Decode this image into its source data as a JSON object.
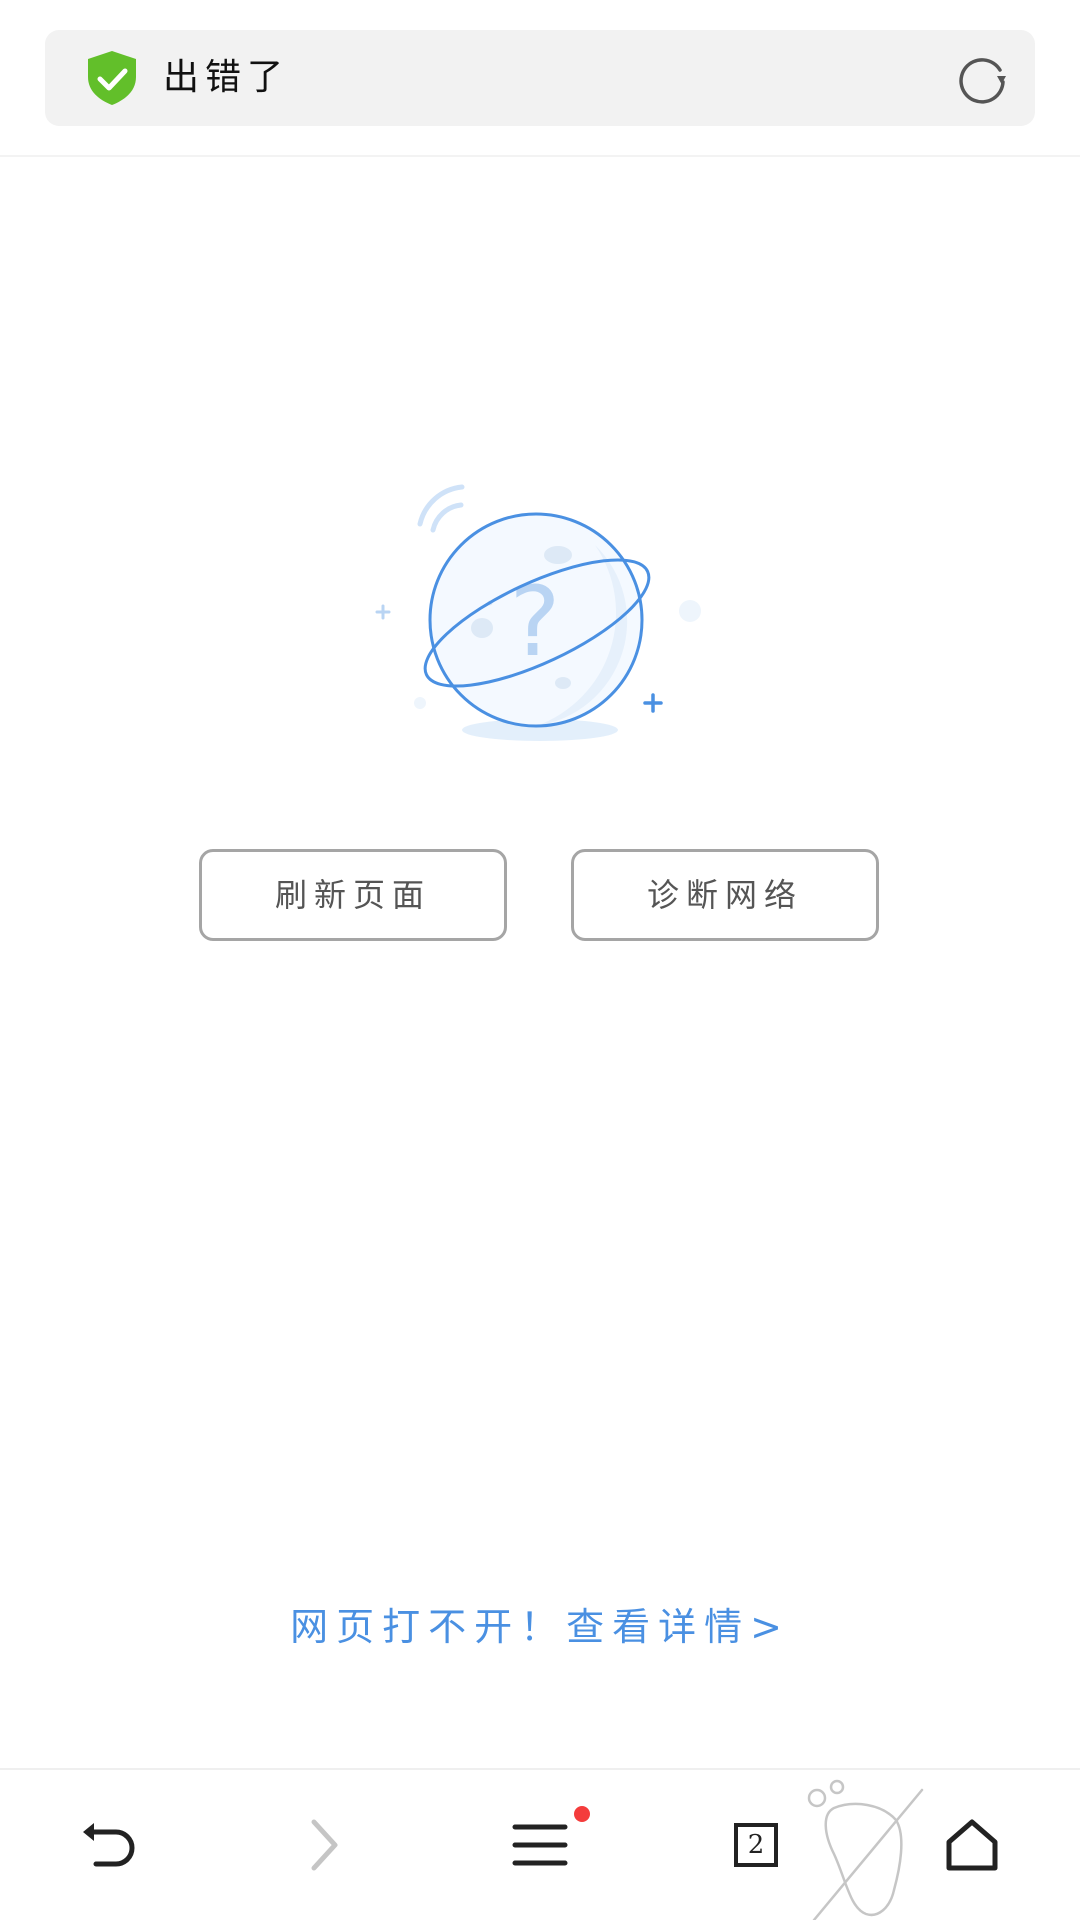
{
  "address_bar": {
    "title": "出错了",
    "secure_icon": "shield-check-icon",
    "reload_icon": "reload-icon"
  },
  "error": {
    "illustration": "planet-question-icon",
    "refresh_label": "刷新页面",
    "diagnose_label": "诊断网络",
    "help_link": "网页打不开！查看详情>"
  },
  "toolbar": {
    "back_icon": "back-arrow-icon",
    "forward_icon": "forward-chevron-icon",
    "menu_icon": "menu-icon",
    "tab_count": "2",
    "home_icon": "home-icon",
    "incognito_icon": "footprint-icon"
  },
  "colors": {
    "shield": "#62bf2a",
    "accent": "#4a90e2",
    "notify": "#f43c3c"
  }
}
